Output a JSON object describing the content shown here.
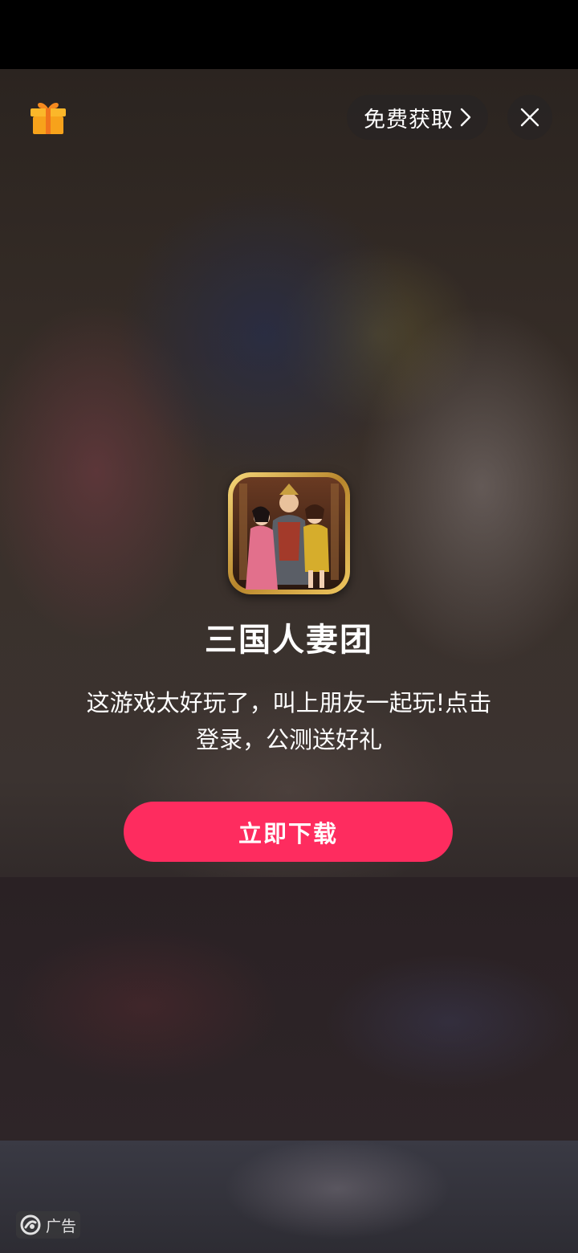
{
  "header": {
    "free_get_label": "免费获取"
  },
  "icons": {
    "gift": "gift-icon",
    "chevron": "chevron-right-icon",
    "close": "close-icon",
    "ad_logo": "ad-logo-icon"
  },
  "app": {
    "title": "三国人妻团",
    "description": "这游戏太好玩了，叫上朋友一起玩!点击登录，公测送好礼"
  },
  "cta": {
    "download_label": "立即下载"
  },
  "footer": {
    "ad_label": "广告"
  },
  "colors": {
    "accent": "#fe2c5f",
    "gift": "#f7a21b"
  }
}
